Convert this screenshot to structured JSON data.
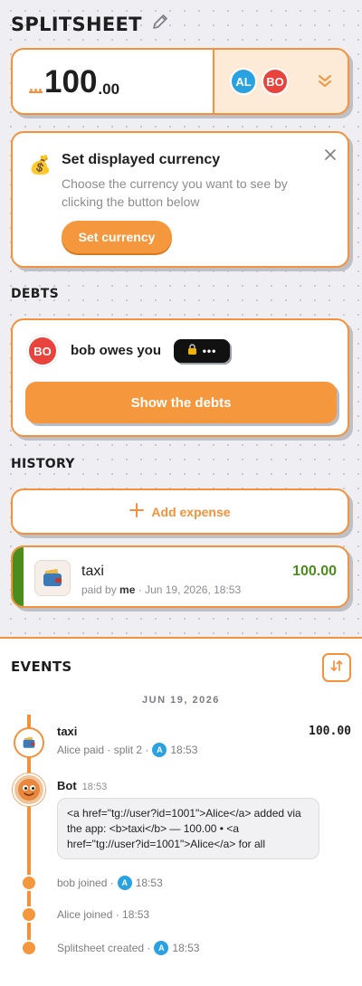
{
  "app": {
    "title": "SPLITSHEET"
  },
  "amount": {
    "dots": "...",
    "integer": "100",
    "decimal": ".00"
  },
  "members": [
    {
      "initials": "AL",
      "color": "#2aa1e0"
    },
    {
      "initials": "BO",
      "color": "#e8433c"
    }
  ],
  "currency_card": {
    "title": "Set displayed currency",
    "description": "Choose the currency you want to see by clicking the button below",
    "button": "Set currency"
  },
  "debts": {
    "section": "DEBTS",
    "avatar": "BO",
    "text": "bob owes you",
    "hidden_amount": "•••",
    "button": "Show the debts"
  },
  "history": {
    "section": "HISTORY",
    "add_label": "Add expense",
    "expense": {
      "title": "taxi",
      "paid_prefix": "paid by",
      "payer": "me",
      "date": "· Jun 19, 2026, 18:53",
      "amount": "100.00"
    }
  },
  "events": {
    "title": "EVENTS",
    "date": "JUN 19, 2026",
    "items": [
      {
        "title": "taxi",
        "meta": "Alice paid · split 2 ·",
        "avatar": "A",
        "time": "18:53",
        "amount": "100.00"
      },
      {
        "bot_name": "Bot",
        "time": "18:53",
        "message": "<a href=\"tg://user?id=1001\">Alice</a> added via the app: <b>taxi</b> — 100.00 • <a href=\"tg://user?id=1001\">Alice</a> for all"
      },
      {
        "meta": "bob joined ·",
        "avatar": "A",
        "time": "18:53"
      },
      {
        "meta": "Alice joined · 18:53"
      },
      {
        "meta": "Splitsheet created ·",
        "avatar": "A",
        "time": "18:53"
      }
    ]
  },
  "colors": {
    "accent": "#f3923a",
    "positive": "#4c8c1c",
    "debtor": "#e8433c",
    "member": "#2aa1e0"
  }
}
